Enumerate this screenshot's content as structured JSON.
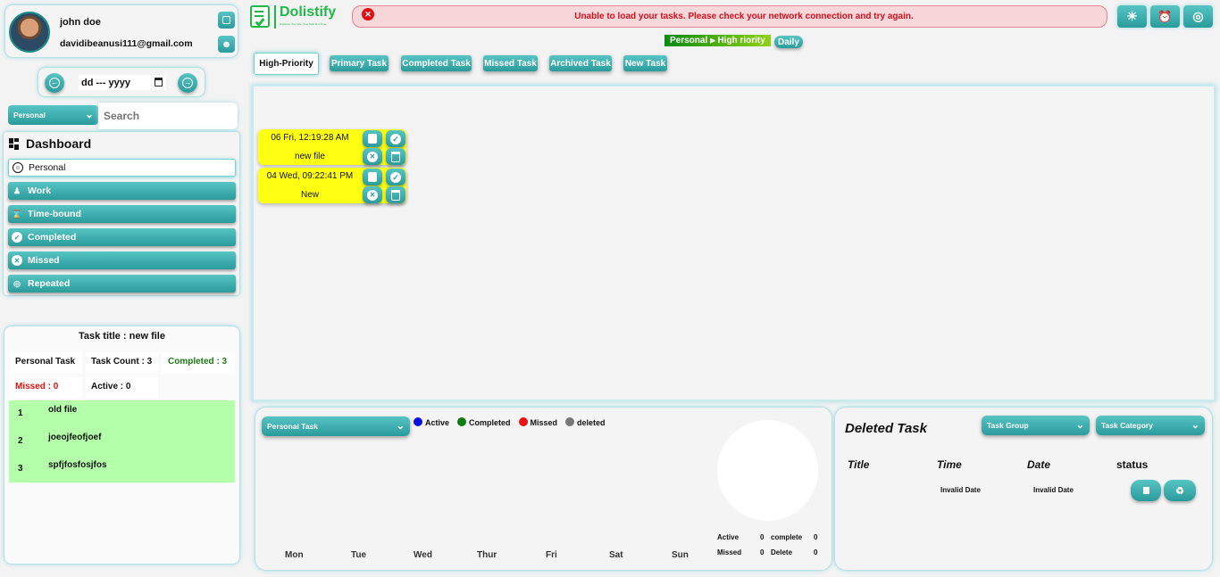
{
  "user": {
    "name": "john doe",
    "email": "davidibeanusi111@gmail.com"
  },
  "date_picker": {
    "value": "dd --- yyyy"
  },
  "category_select": {
    "value": "Personal"
  },
  "search": {
    "placeholder": "Search"
  },
  "sidebar": {
    "heading": "Dashboard",
    "items": [
      {
        "label": "Personal",
        "icon": "person-circle-icon",
        "active": true
      },
      {
        "label": "Work",
        "icon": "people-icon"
      },
      {
        "label": "Time-bound",
        "icon": "hourglass-icon"
      },
      {
        "label": "Completed",
        "icon": "check-circle-icon"
      },
      {
        "label": "Missed",
        "icon": "x-circle-icon"
      },
      {
        "label": "Repeated",
        "icon": "target-arrow-icon"
      }
    ]
  },
  "task_info": {
    "title": "Task title : new file",
    "personal_task": "Personal Task",
    "task_count": "Task Count : 3",
    "completed": "Completed : 3",
    "missed": "Missed : 0",
    "active": "Active : 0",
    "list": [
      {
        "num": "1",
        "name": "old file"
      },
      {
        "num": "2",
        "name": "joeojfeofjoef"
      },
      {
        "num": "3",
        "name": "spfjfosfosjfos"
      }
    ]
  },
  "brand": {
    "name": "Dolistify",
    "tagline": "Organize Your Life, One Task at a Time"
  },
  "error": {
    "message": "Unable to load your tasks. Please check your network connection and try again."
  },
  "breadcrumb": {
    "path": "Personal ⫸ High riority",
    "badge": "Daily"
  },
  "tabs": [
    "High-Priority",
    "Primary Task",
    "Completed Task",
    "Missed Task",
    "Archived Task",
    "New Task"
  ],
  "tasks": [
    {
      "date": "06 Fri, 12:19:28 AM",
      "name": "new file"
    },
    {
      "date": "04 Wed, 09:22:41 PM",
      "name": "New"
    }
  ],
  "chart_panel": {
    "select": "Personal Task",
    "legend": [
      {
        "label": "Active",
        "color": "#0a10e0"
      },
      {
        "label": "Completed",
        "color": "#0d7a12"
      },
      {
        "label": "Missed",
        "color": "#e81010"
      },
      {
        "label": "deleted",
        "color": "#777777"
      }
    ],
    "days": [
      "Mon",
      "Tue",
      "Wed",
      "Thur",
      "Fri",
      "Sat",
      "Sun"
    ],
    "stats": {
      "active_label": "Active",
      "active": "0",
      "complete_label": "complete",
      "complete": "0",
      "missed_label": "Missed",
      "missed": "0",
      "delete_label": "Delete",
      "delete": "0"
    }
  },
  "deleted_panel": {
    "title": "Deleted Task",
    "group_select": "Task Group",
    "category_select": "Task Category",
    "headers": [
      "Title",
      "Time",
      "Date",
      "status"
    ],
    "rows": [
      {
        "title": "",
        "time": "Invalid Date",
        "date": "Invalid Date"
      }
    ]
  },
  "colors": {
    "accent": "#2a9b9b",
    "task_bg": "#ffff14",
    "error_bg": "#f8d7da",
    "error_text": "#d20f1c",
    "list_bg": "#b4ffaa"
  }
}
